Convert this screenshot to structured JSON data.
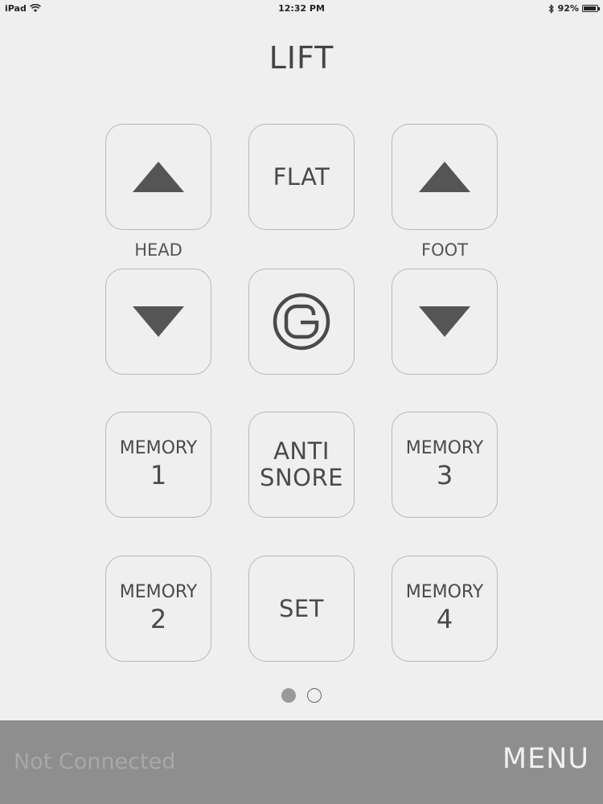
{
  "status_bar": {
    "device": "iPad",
    "time": "12:32 PM",
    "battery": "92%",
    "battery_level": 0.92
  },
  "title": "LIFT",
  "labels": {
    "head": "HEAD",
    "foot": "FOOT"
  },
  "buttons": {
    "flat": "FLAT",
    "anti_snore_line1": "ANTI",
    "anti_snore_line2": "SNORE",
    "set": "SET",
    "memory_label": "MEMORY",
    "memory1": "1",
    "memory2": "2",
    "memory3": "3",
    "memory4": "4"
  },
  "icons": {
    "head_up": "up-triangle-icon",
    "head_down": "down-triangle-icon",
    "foot_up": "up-triangle-icon",
    "foot_down": "down-triangle-icon",
    "center": "logo-g-icon",
    "wifi": "wifi-icon",
    "bluetooth": "bluetooth-icon",
    "battery": "battery-icon"
  },
  "pagination": {
    "current": 1,
    "total": 2
  },
  "footer": {
    "connection_status": "Not Connected",
    "menu": "MENU"
  },
  "colors": {
    "background": "#efefef",
    "footer": "#8e8e8e",
    "icon": "#555555"
  }
}
